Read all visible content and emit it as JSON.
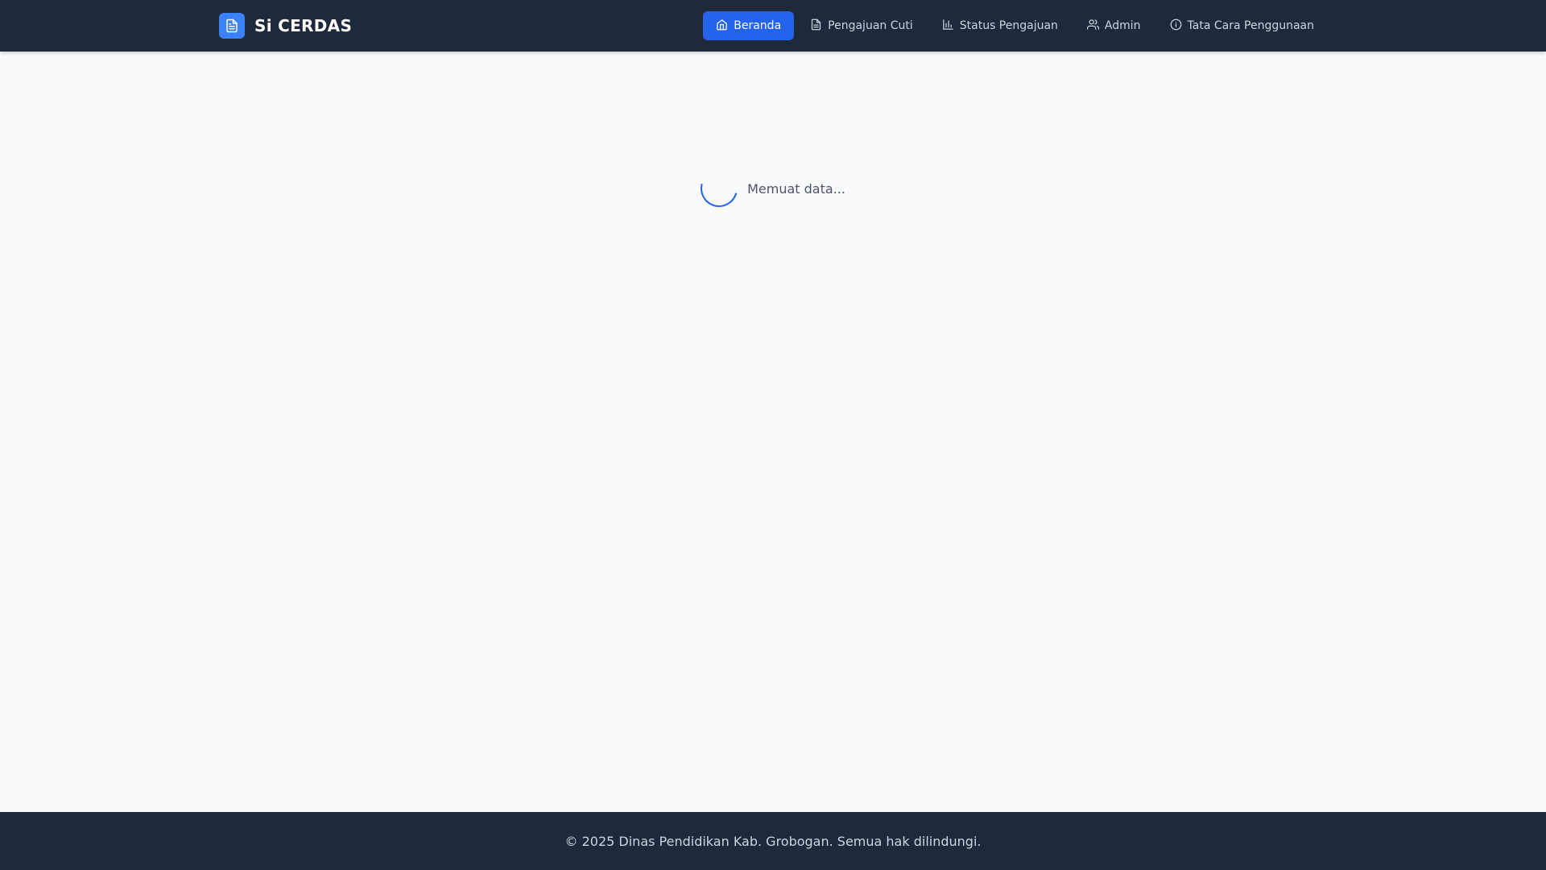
{
  "brand": {
    "name": "Si CERDAS",
    "logo_icon": "document-icon",
    "accent": "#3b82f6"
  },
  "nav": {
    "items": [
      {
        "label": "Beranda",
        "icon": "home-icon",
        "active": true
      },
      {
        "label": "Pengajuan Cuti",
        "icon": "document-icon",
        "active": false
      },
      {
        "label": "Status Pengajuan",
        "icon": "bar-chart-icon",
        "active": false
      },
      {
        "label": "Admin",
        "icon": "users-icon",
        "active": false
      },
      {
        "label": "Tata Cara Penggunaan",
        "icon": "info-icon",
        "active": false
      }
    ],
    "active_color": "#2563eb"
  },
  "main": {
    "loading_text": "Memuat data..."
  },
  "footer": {
    "text": "© 2025 Dinas Pendidikan Kab. Grobogan. Semua hak dilindungi."
  },
  "colors": {
    "header_bg": "#1e293b",
    "page_bg": "#f8fafc",
    "footer_bg": "#1e293b"
  }
}
